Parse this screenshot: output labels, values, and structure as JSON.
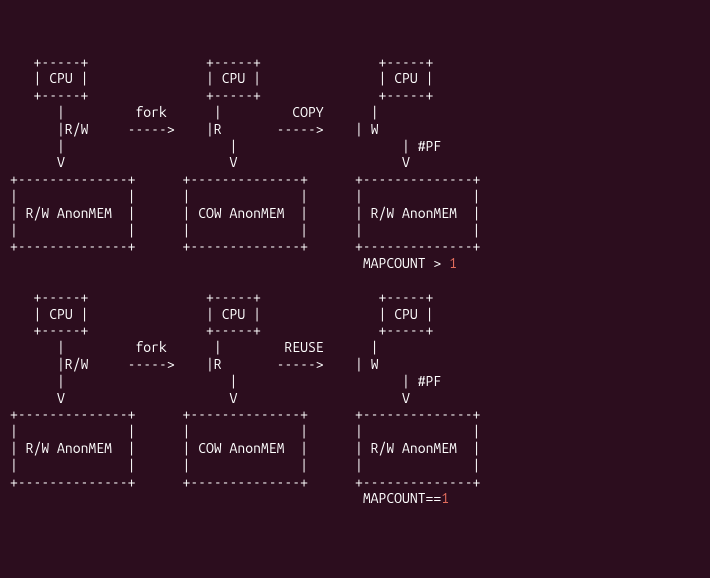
{
  "diagram": {
    "top": {
      "cpu1": "CPU",
      "cpu2": "CPU",
      "cpu3": "CPU",
      "op1": "fork",
      "op2": "COPY",
      "mode1": "R/W",
      "mode2": "R",
      "mode3a": "W",
      "mode3b": "#PF",
      "mem1": "R/W AnonMEM",
      "mem2": "COW AnonMEM",
      "mem3": "R/W AnonMEM",
      "mapcount_label": "MAPCOUNT >",
      "mapcount_value": "1"
    },
    "bottom": {
      "cpu1": "CPU",
      "cpu2": "CPU",
      "cpu3": "CPU",
      "op1": "fork",
      "op2": "REUSE",
      "mode1": "R/W",
      "mode2": "R",
      "mode3a": "W",
      "mode3b": "#PF",
      "mem1": "R/W AnonMEM",
      "mem2": "COW AnonMEM",
      "mem3": "R/W AnonMEM",
      "mapcount_label": "MAPCOUNT==",
      "mapcount_value": "1"
    }
  }
}
